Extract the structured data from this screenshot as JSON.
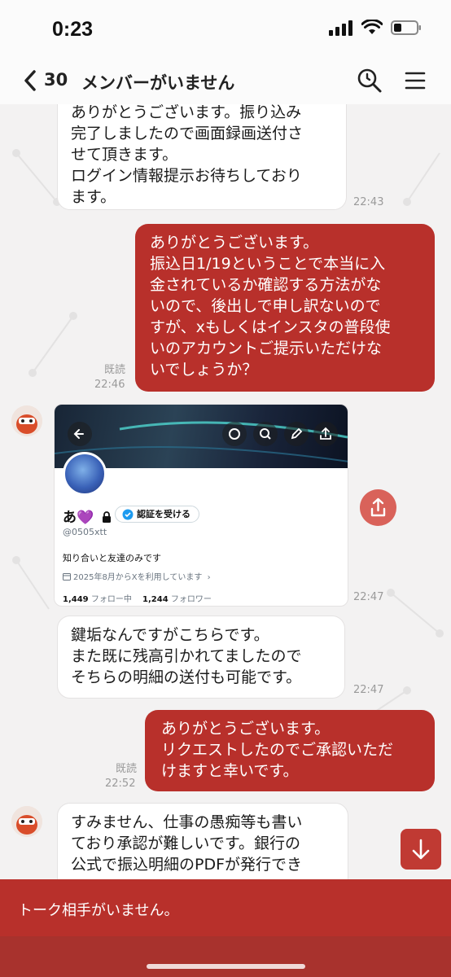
{
  "status_bar": {
    "time": "0:23"
  },
  "header": {
    "back_count": "30",
    "title": "メンバーがいません"
  },
  "messages": [
    {
      "text": "ありがとうございます。振り込み\n完了しましたので画面録画送付さ\nせて頂きます。\nログイン情報提示お待ちしており\nます。",
      "time": "22:43"
    },
    {
      "text": "ありがとうございます。\n振込日1/19ということで本当に入\n金されているか確認する方法がな\nいので、後出しで申し訳ないので\nすが、xもしくはインスタの普段使\nいのアカウントご提示いただけな\nいでしょうか？",
      "read": "既読",
      "time": "22:46"
    },
    {
      "time": "22:47"
    },
    {
      "text": "鍵垢なんですがこちらです。\nまた既に残高引かれてましたので\nそちらの明細の送付も可能です。",
      "time": "22:47"
    },
    {
      "text": "ありがとうございます。\nリクエストしたのでご承認いただ\nけますと幸いです。",
      "read": "既読",
      "time": "22:52"
    },
    {
      "text": "すみません、仕事の愚痴等も書い\nており承認が難しいです。銀行の\n公式で振込明細のPDFが発行でき"
    }
  ],
  "profile_card": {
    "name": "あ💜",
    "verify_label": "認証を受ける",
    "handle": "@0505xtt",
    "bio": "知り合いと友達のみです",
    "joined": "2025年8月からXを利用しています",
    "following_count": "1,449",
    "following_label": "フォロー中",
    "followers_count": "1,244",
    "followers_label": "フォロワー"
  },
  "footer": {
    "text": "トーク相手がいません。"
  },
  "colors": {
    "accent": "#b8302b",
    "incoming_bubble": "#ffffff",
    "background": "#f3f2f2"
  }
}
